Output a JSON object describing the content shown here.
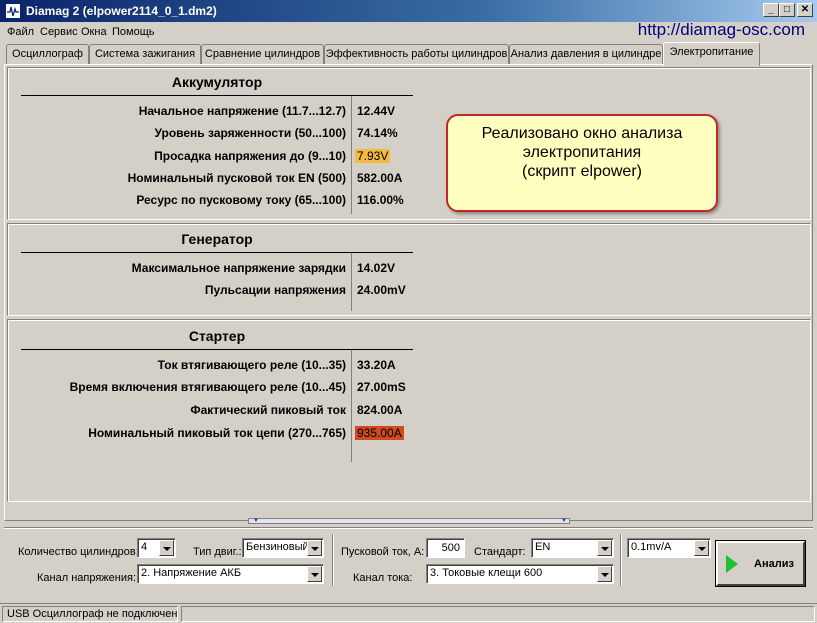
{
  "window": {
    "title": "Diamag 2 (elpower2114_0_1.dm2)",
    "controls": {
      "minimize": "_",
      "maximize": "□",
      "close": "✕"
    }
  },
  "menu": {
    "items": [
      "Файл",
      "Сервис",
      "Окна",
      "Помощь"
    ]
  },
  "site_url": "http://diamag-osc.com",
  "tabs": [
    {
      "label": "Осциллограф"
    },
    {
      "label": "Система зажигания"
    },
    {
      "label": "Сравнение цилиндров"
    },
    {
      "label": "Эффективность работы цилиндров"
    },
    {
      "label": "Анализ давления в цилиндре"
    },
    {
      "label": "Электропитание",
      "active": true
    }
  ],
  "battery": {
    "title": "Аккумулятор",
    "rows": [
      {
        "label": "Начальное напряжение (11.7...12.7)",
        "value": "12.44V"
      },
      {
        "label": "Уровень заряженности (50...100)",
        "value": "74.14%"
      },
      {
        "label": "Просадка напряжения до (9...10)",
        "value": "7.93V",
        "highlight": "yellow"
      },
      {
        "label": "Номинальный пусковой ток EN (500)",
        "value": "582.00A"
      },
      {
        "label": "Ресурс по пусковому току (65...100)",
        "value": "116.00%"
      }
    ]
  },
  "generator": {
    "title": "Генератор",
    "rows": [
      {
        "label": "Максимальное напряжение зарядки",
        "value": "14.02V"
      },
      {
        "label": "Пульсации напряжения",
        "value": "24.00mV"
      }
    ]
  },
  "starter": {
    "title": "Стартер",
    "rows": [
      {
        "label": "Ток втягивающего реле (10...35)",
        "value": "33.20A"
      },
      {
        "label": "Время включения втягивающего реле (10...45)",
        "value": "27.00mS"
      },
      {
        "label": "Фактический пиковый ток",
        "value": "824.00A"
      },
      {
        "label": "Номинальный пиковый ток цепи (270...765)",
        "value": "935.00A",
        "highlight": "red"
      }
    ]
  },
  "callout": {
    "lines": [
      "Реализовано окно анализа",
      "электропитания",
      "(скрипт elpower)"
    ]
  },
  "controls": {
    "cylinders_label": "Количество цилиндров:",
    "cylinders_value": "4",
    "engine_type_label": "Тип двиг.:",
    "engine_type_value": "Бензиновый",
    "voltage_channel_label": "Канал напряжения:",
    "voltage_channel_value": "2.  Напряжение АКБ",
    "start_current_label": "Пусковой ток, А:",
    "start_current_value": "500",
    "standard_label": "Стандарт:",
    "standard_value": "EN",
    "current_channel_label": "Канал тока:",
    "current_channel_value": "3.  Токовые клещи 600",
    "probe_value": "0.1mv/A",
    "analyze_label": "Анализ"
  },
  "status": {
    "text": "USB Осциллограф не подключен"
  },
  "colors": {
    "highlight_yellow": "#f5b942",
    "highlight_red": "#d04a1f",
    "callout_border": "#c0262c",
    "callout_fill": "#ffffc0"
  }
}
